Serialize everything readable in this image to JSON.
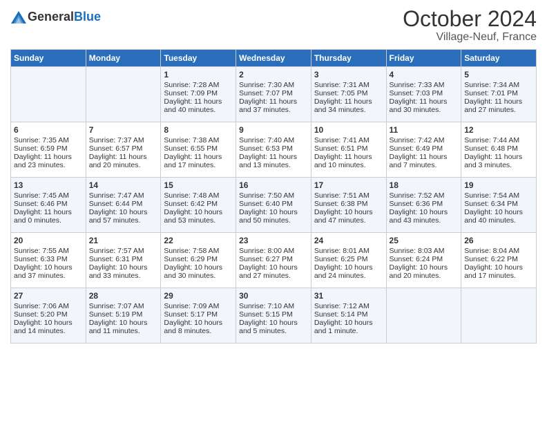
{
  "header": {
    "logo_general": "General",
    "logo_blue": "Blue",
    "month": "October 2024",
    "location": "Village-Neuf, France"
  },
  "columns": [
    "Sunday",
    "Monday",
    "Tuesday",
    "Wednesday",
    "Thursday",
    "Friday",
    "Saturday"
  ],
  "weeks": [
    [
      {
        "day": "",
        "text": ""
      },
      {
        "day": "",
        "text": ""
      },
      {
        "day": "1",
        "text": "Sunrise: 7:28 AM\nSunset: 7:09 PM\nDaylight: 11 hours and 40 minutes."
      },
      {
        "day": "2",
        "text": "Sunrise: 7:30 AM\nSunset: 7:07 PM\nDaylight: 11 hours and 37 minutes."
      },
      {
        "day": "3",
        "text": "Sunrise: 7:31 AM\nSunset: 7:05 PM\nDaylight: 11 hours and 34 minutes."
      },
      {
        "day": "4",
        "text": "Sunrise: 7:33 AM\nSunset: 7:03 PM\nDaylight: 11 hours and 30 minutes."
      },
      {
        "day": "5",
        "text": "Sunrise: 7:34 AM\nSunset: 7:01 PM\nDaylight: 11 hours and 27 minutes."
      }
    ],
    [
      {
        "day": "6",
        "text": "Sunrise: 7:35 AM\nSunset: 6:59 PM\nDaylight: 11 hours and 23 minutes."
      },
      {
        "day": "7",
        "text": "Sunrise: 7:37 AM\nSunset: 6:57 PM\nDaylight: 11 hours and 20 minutes."
      },
      {
        "day": "8",
        "text": "Sunrise: 7:38 AM\nSunset: 6:55 PM\nDaylight: 11 hours and 17 minutes."
      },
      {
        "day": "9",
        "text": "Sunrise: 7:40 AM\nSunset: 6:53 PM\nDaylight: 11 hours and 13 minutes."
      },
      {
        "day": "10",
        "text": "Sunrise: 7:41 AM\nSunset: 6:51 PM\nDaylight: 11 hours and 10 minutes."
      },
      {
        "day": "11",
        "text": "Sunrise: 7:42 AM\nSunset: 6:49 PM\nDaylight: 11 hours and 7 minutes."
      },
      {
        "day": "12",
        "text": "Sunrise: 7:44 AM\nSunset: 6:48 PM\nDaylight: 11 hours and 3 minutes."
      }
    ],
    [
      {
        "day": "13",
        "text": "Sunrise: 7:45 AM\nSunset: 6:46 PM\nDaylight: 11 hours and 0 minutes."
      },
      {
        "day": "14",
        "text": "Sunrise: 7:47 AM\nSunset: 6:44 PM\nDaylight: 10 hours and 57 minutes."
      },
      {
        "day": "15",
        "text": "Sunrise: 7:48 AM\nSunset: 6:42 PM\nDaylight: 10 hours and 53 minutes."
      },
      {
        "day": "16",
        "text": "Sunrise: 7:50 AM\nSunset: 6:40 PM\nDaylight: 10 hours and 50 minutes."
      },
      {
        "day": "17",
        "text": "Sunrise: 7:51 AM\nSunset: 6:38 PM\nDaylight: 10 hours and 47 minutes."
      },
      {
        "day": "18",
        "text": "Sunrise: 7:52 AM\nSunset: 6:36 PM\nDaylight: 10 hours and 43 minutes."
      },
      {
        "day": "19",
        "text": "Sunrise: 7:54 AM\nSunset: 6:34 PM\nDaylight: 10 hours and 40 minutes."
      }
    ],
    [
      {
        "day": "20",
        "text": "Sunrise: 7:55 AM\nSunset: 6:33 PM\nDaylight: 10 hours and 37 minutes."
      },
      {
        "day": "21",
        "text": "Sunrise: 7:57 AM\nSunset: 6:31 PM\nDaylight: 10 hours and 33 minutes."
      },
      {
        "day": "22",
        "text": "Sunrise: 7:58 AM\nSunset: 6:29 PM\nDaylight: 10 hours and 30 minutes."
      },
      {
        "day": "23",
        "text": "Sunrise: 8:00 AM\nSunset: 6:27 PM\nDaylight: 10 hours and 27 minutes."
      },
      {
        "day": "24",
        "text": "Sunrise: 8:01 AM\nSunset: 6:25 PM\nDaylight: 10 hours and 24 minutes."
      },
      {
        "day": "25",
        "text": "Sunrise: 8:03 AM\nSunset: 6:24 PM\nDaylight: 10 hours and 20 minutes."
      },
      {
        "day": "26",
        "text": "Sunrise: 8:04 AM\nSunset: 6:22 PM\nDaylight: 10 hours and 17 minutes."
      }
    ],
    [
      {
        "day": "27",
        "text": "Sunrise: 7:06 AM\nSunset: 5:20 PM\nDaylight: 10 hours and 14 minutes."
      },
      {
        "day": "28",
        "text": "Sunrise: 7:07 AM\nSunset: 5:19 PM\nDaylight: 10 hours and 11 minutes."
      },
      {
        "day": "29",
        "text": "Sunrise: 7:09 AM\nSunset: 5:17 PM\nDaylight: 10 hours and 8 minutes."
      },
      {
        "day": "30",
        "text": "Sunrise: 7:10 AM\nSunset: 5:15 PM\nDaylight: 10 hours and 5 minutes."
      },
      {
        "day": "31",
        "text": "Sunrise: 7:12 AM\nSunset: 5:14 PM\nDaylight: 10 hours and 1 minute."
      },
      {
        "day": "",
        "text": ""
      },
      {
        "day": "",
        "text": ""
      }
    ]
  ]
}
